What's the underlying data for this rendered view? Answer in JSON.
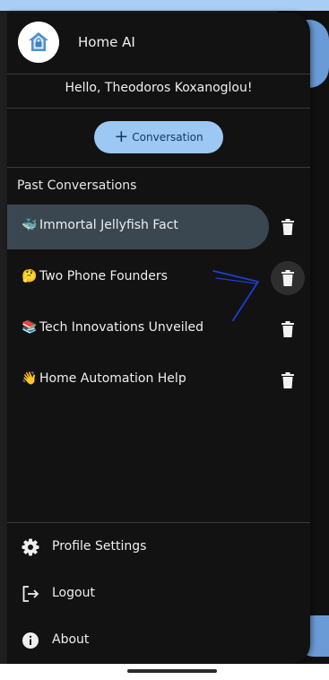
{
  "app": {
    "title": "Home AI",
    "greeting": "Hello, Theodoros Koxanoglou!"
  },
  "new_conversation": {
    "icon": "+",
    "label": "Conversation"
  },
  "past_section": {
    "title": "Past Conversations"
  },
  "conversations": [
    {
      "emoji": "🐳",
      "title": "Immortal Jellyfish Fact",
      "active": true
    },
    {
      "emoji": "🤔",
      "title": "Two Phone Founders",
      "active": false
    },
    {
      "emoji": "📚",
      "title": "Tech Innovations Unveiled",
      "active": false
    },
    {
      "emoji": "👋",
      "title": "Home Automation Help",
      "active": false
    }
  ],
  "footer": [
    {
      "icon": "gear-icon",
      "label": "Profile Settings"
    },
    {
      "icon": "logout-icon",
      "label": "Logout"
    },
    {
      "icon": "info-icon",
      "label": "About"
    }
  ],
  "colors": {
    "drawer_bg": "#121212",
    "accent_button": "#9cc8f3",
    "active_item": "#3a4750",
    "annotation_arrow": "#1d3fd0",
    "top_strip": "#a9cdf5"
  }
}
